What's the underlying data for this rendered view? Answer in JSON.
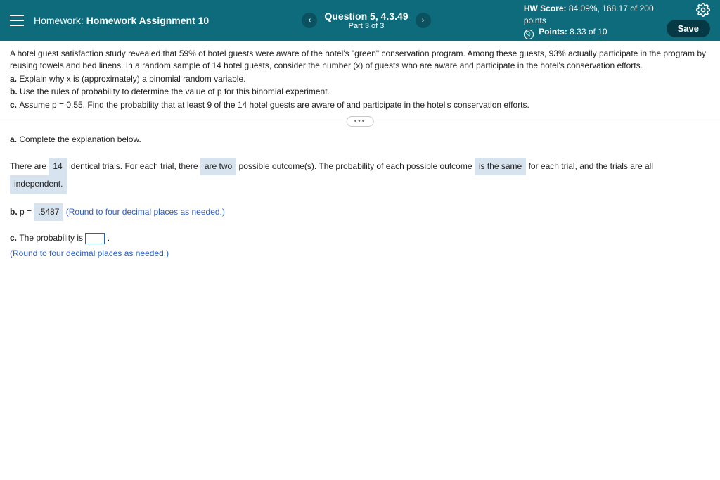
{
  "header": {
    "hw_prefix": "Homework:",
    "hw_name": "Homework Assignment 10",
    "question_title": "Question 5, 4.3.49",
    "question_sub": "Part 3 of 3",
    "score_line1_label": "HW Score:",
    "score_line1_value": "84.09%, 168.17 of 200",
    "score_line2": "points",
    "points_label": "Points:",
    "points_value": "8.33 of 10",
    "save_label": "Save"
  },
  "problem": {
    "intro": "A hotel guest satisfaction study revealed that 59% of hotel guests were aware of the hotel's \"green\" conservation program. Among these guests, 93% actually participate in the program by reusing towels and bed linens. In a random sample of 14 hotel guests, consider the number (x) of guests who are aware and participate in the hotel's conservation efforts.",
    "a": "Explain why x is (approximately) a binomial random variable.",
    "b": "Use the rules of probability to determine the value of p for this binomial experiment.",
    "c": "Assume p = 0.55. Find the probability that at least 9 of the 14 hotel guests are aware of and participate in the hotel's conservation efforts."
  },
  "answers": {
    "a_prompt": "Complete the explanation below.",
    "a_text1": "There are",
    "a_chip1": "14",
    "a_text2": "identical trials. For each trial, there",
    "a_chip2": "are two",
    "a_text3": "possible outcome(s). The probability of each possible outcome",
    "a_chip3": "is the same",
    "a_text4": "for each trial, and the trials are all",
    "a_chip4": "independent.",
    "b_label": "p =",
    "b_value": ".5487",
    "b_hint": "(Round to four decimal places as needed.)",
    "c_text1": "The probability is",
    "c_hint": "(Round to four decimal places as needed.)"
  }
}
